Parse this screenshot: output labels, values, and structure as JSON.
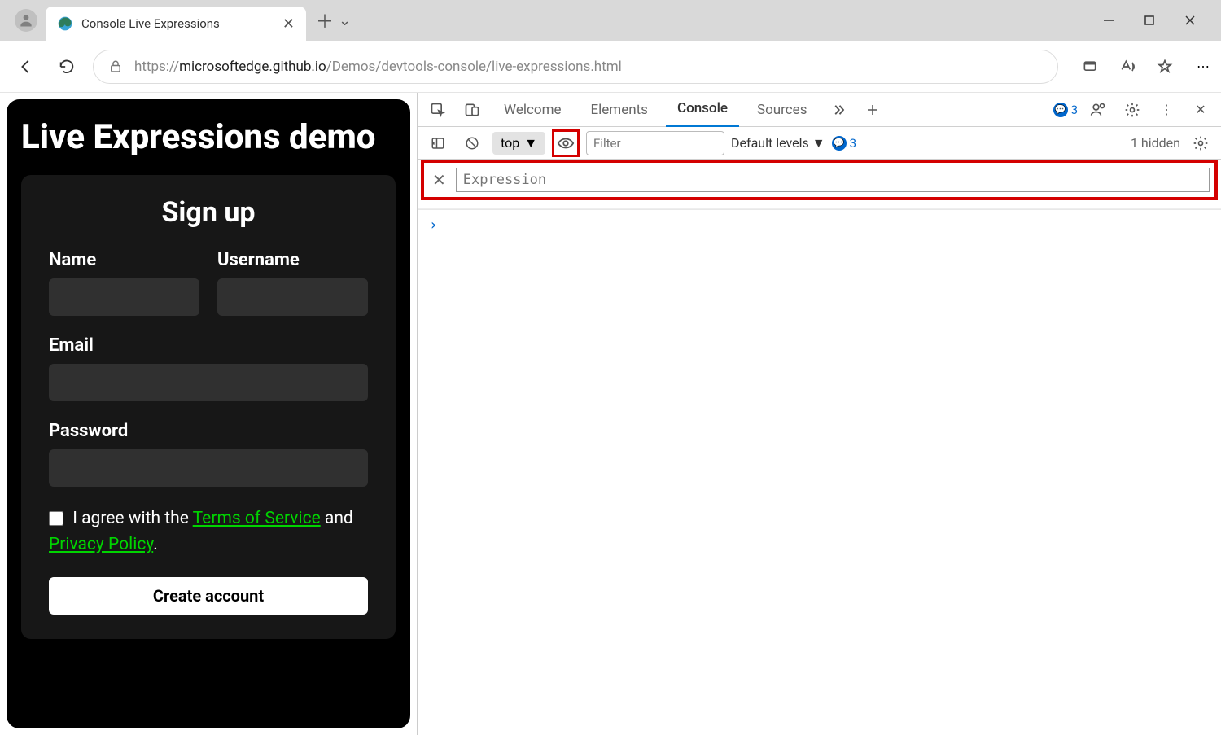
{
  "window": {
    "tab_title": "Console Live Expressions"
  },
  "navbar": {
    "url_prefix": "https://",
    "url_host": "microsoftedge.github.io",
    "url_path": "/Demos/devtools-console/live-expressions.html"
  },
  "page": {
    "heading": "Live Expressions demo",
    "card_title": "Sign up",
    "labels": {
      "name": "Name",
      "username": "Username",
      "email": "Email",
      "password": "Password"
    },
    "agree": {
      "prefix": "I agree with the ",
      "tos": "Terms of Service",
      "mid": " and ",
      "privacy": "Privacy Policy",
      "suffix": "."
    },
    "create_btn": "Create account"
  },
  "devtools": {
    "tabs": {
      "welcome": "Welcome",
      "elements": "Elements",
      "console": "Console",
      "sources": "Sources"
    },
    "issues_count": "3",
    "toolbar": {
      "context": "top",
      "filter_placeholder": "Filter",
      "levels": "Default levels",
      "msg_count": "3",
      "hidden": "1 hidden"
    },
    "expression": {
      "placeholder": "Expression"
    },
    "prompt": "›"
  }
}
